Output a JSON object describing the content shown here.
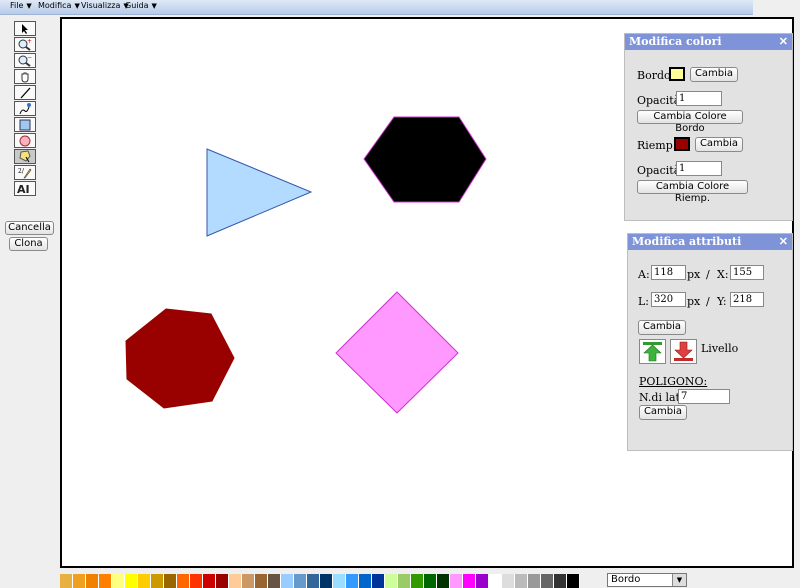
{
  "menu": [
    "File",
    "Modifica",
    "Visualizza",
    "Guida"
  ],
  "tools": [
    "pointer-icon",
    "zoom-in-icon",
    "zoom-out-icon",
    "hand-pan-icon",
    "line-icon",
    "pen-icon",
    "rectangle-icon",
    "ellipse-icon",
    "polygon-icon",
    "freehand-icon",
    "text-icon"
  ],
  "actions": {
    "delete": "Cancella",
    "clone": "Clona"
  },
  "colors_panel": {
    "title": "Modifica colori",
    "border_label": "Bordo:",
    "border_color": "#ffff99",
    "change": "Cambia",
    "opacity_label": "Opacità:",
    "border_opacity": "1",
    "change_border": "Cambia Colore Bordo",
    "fill_label": "Riemp.:",
    "fill_color": "#990000",
    "fill_opacity": "1",
    "change_fill": "Cambia Colore Riemp."
  },
  "attr_panel": {
    "title": "Modifica attributi",
    "a_label": "A:",
    "a_value": "118",
    "px": "px",
    "slash": "/",
    "x_label": "X:",
    "x_value": "155",
    "l_label": "L:",
    "l_value": "320",
    "y_label": "Y:",
    "y_value": "218",
    "change": "Cambia",
    "level": "Livello",
    "polygon_heading": "POLIGONO:",
    "sides_label": "N.di lati:",
    "sides_value": "7"
  },
  "shapes": [
    {
      "type": "triangle",
      "fill": "#b3dbff",
      "stroke": "#3355aa"
    },
    {
      "type": "hexagon",
      "fill": "#000000",
      "stroke": "#cc33cc"
    },
    {
      "type": "heptagon",
      "fill": "#990000",
      "stroke": "#990000"
    },
    {
      "type": "diamond",
      "fill": "#ff99ff",
      "stroke": "#cc33cc"
    }
  ],
  "palette": [
    "#e8b040",
    "#f0a020",
    "#f08000",
    "#ff7f00",
    "#ffff80",
    "#ffff00",
    "#ffcc00",
    "#cc9900",
    "#996600",
    "#ff6600",
    "#ff3300",
    "#cc0000",
    "#990000",
    "#ffcc99",
    "#cc9966",
    "#996633",
    "#665544",
    "#99ccff",
    "#6699cc",
    "#336699",
    "#003366",
    "#99ddff",
    "#3399ff",
    "#0066cc",
    "#003399",
    "#ccff99",
    "#99cc66",
    "#339900",
    "#006600",
    "#003300",
    "#ff99ff",
    "#ff00ff",
    "#9900cc",
    "#ffffff",
    "#dddddd",
    "#bbbbbb",
    "#999999",
    "#666666",
    "#333333",
    "#000000"
  ],
  "selector": {
    "value": "Bordo"
  }
}
